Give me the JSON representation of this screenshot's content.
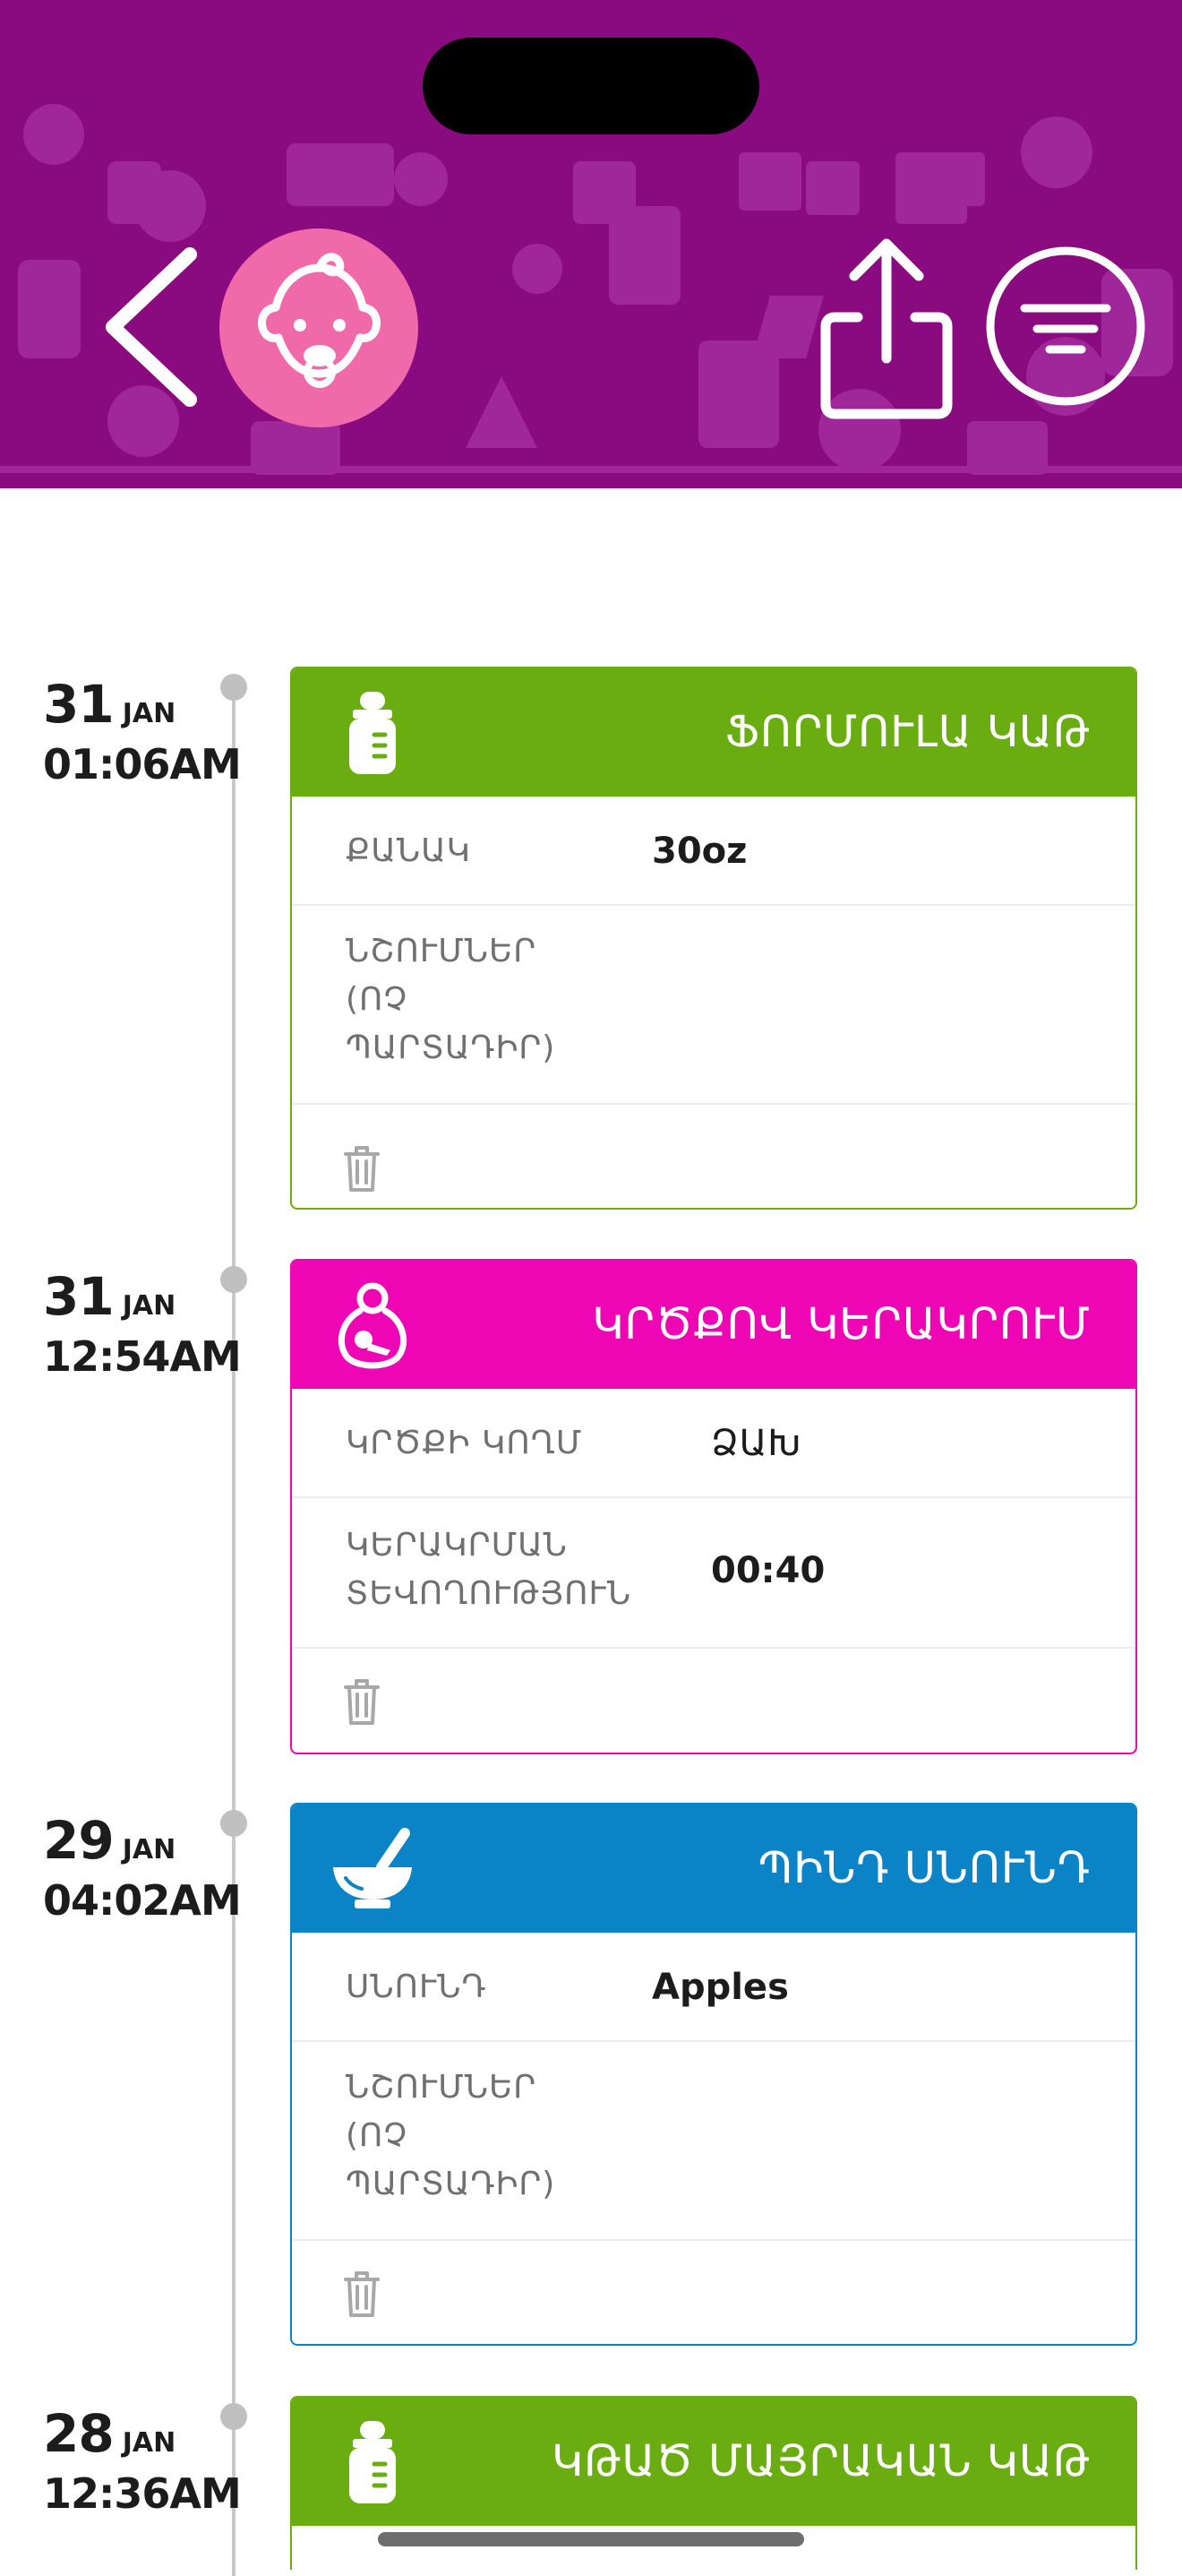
{
  "header": {
    "back_icon": "chevron-left-icon",
    "avatar_icon": "baby-face-icon",
    "share_icon": "share-icon",
    "filter_icon": "filter-icon",
    "background_color": "#8a0b80",
    "avatar_color": "#f06aa9"
  },
  "entries": [
    {
      "date": {
        "day": "31",
        "month": "JAN",
        "time": "01:06AM"
      },
      "type": "formula",
      "color": "#6aad10",
      "icon": "baby-bottle-icon",
      "title": "ՖՈՐՄՈՒԼԱ ԿԱԹ",
      "rows": [
        {
          "label": "ՔԱՆԱԿ",
          "value": "30oz"
        },
        {
          "label": "ՆՇՈՒՄՆԵՐ (ՈՉ ՊԱՐՏԱԴԻՐ)",
          "value": ""
        }
      ]
    },
    {
      "date": {
        "day": "31",
        "month": "JAN",
        "time": "12:54AM"
      },
      "type": "breastfeeding",
      "color": "#ee06b4",
      "icon": "breastfeeding-icon",
      "title": "ԿՐԾՔՈՎ ԿԵՐԱԿՐՈՒՄ",
      "rows": [
        {
          "label": "ԿՐԾՔԻ ԿՈՂՄ",
          "value": "ՁԱԽ"
        },
        {
          "label": "ԿԵՐԱԿՐՄԱՆ ՏԵՎՈՂՈՒԹՅՈՒՆ",
          "value": "00:40"
        }
      ]
    },
    {
      "date": {
        "day": "29",
        "month": "JAN",
        "time": "04:02AM"
      },
      "type": "solid-food",
      "color": "#0a84c6",
      "icon": "mortar-pestle-icon",
      "title": "ՊԻՆԴ ՍՆՈՒՆԴ",
      "rows": [
        {
          "label": "ՍՆՈՒՆԴ",
          "value": "Apples"
        },
        {
          "label": "ՆՇՈՒՄՆԵՐ (ՈՉ ՊԱՐՏԱԴԻՐ)",
          "value": ""
        }
      ]
    },
    {
      "date": {
        "day": "28",
        "month": "JAN",
        "time": "12:36AM"
      },
      "type": "expressed-milk",
      "color": "#6aad10",
      "icon": "baby-bottle-icon",
      "title": "ԿԹԱԾ ՄԱՅՐԱԿԱՆ ԿԱԹ",
      "rows": []
    }
  ],
  "delete_icon": "trash-icon"
}
